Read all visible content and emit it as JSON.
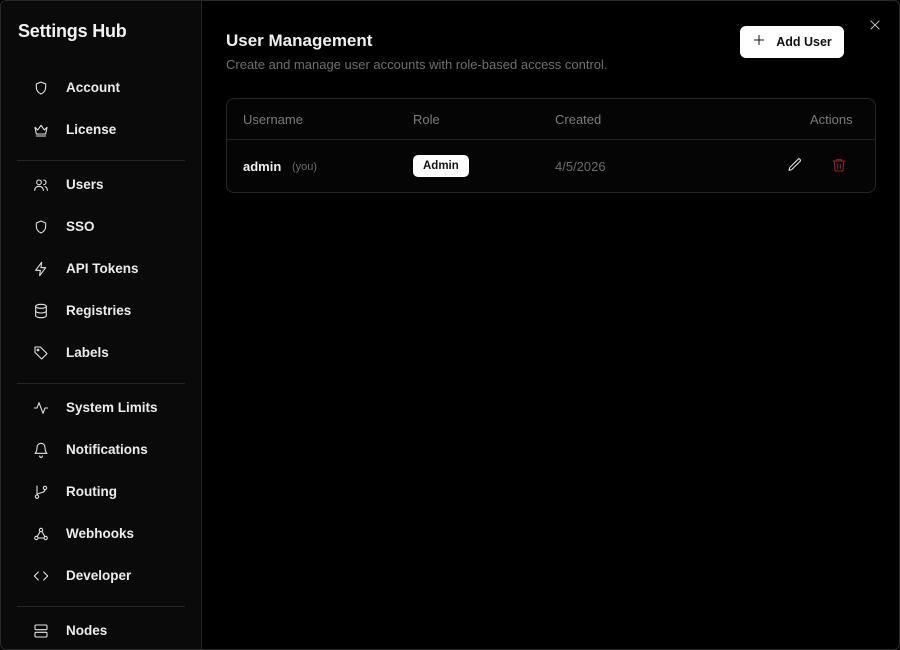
{
  "sidebar": {
    "title": "Settings Hub",
    "groups": [
      [
        {
          "label": "Account",
          "icon": "shield-icon"
        },
        {
          "label": "License",
          "icon": "crown-icon"
        }
      ],
      [
        {
          "label": "Users",
          "icon": "users-icon"
        },
        {
          "label": "SSO",
          "icon": "shield-icon"
        },
        {
          "label": "API Tokens",
          "icon": "lightning-icon"
        },
        {
          "label": "Registries",
          "icon": "database-icon"
        },
        {
          "label": "Labels",
          "icon": "tag-icon"
        }
      ],
      [
        {
          "label": "System Limits",
          "icon": "activity-icon"
        },
        {
          "label": "Notifications",
          "icon": "bell-icon"
        },
        {
          "label": "Routing",
          "icon": "git-branch-icon"
        },
        {
          "label": "Webhooks",
          "icon": "webhook-icon"
        },
        {
          "label": "Developer",
          "icon": "code-icon"
        }
      ],
      [
        {
          "label": "Nodes",
          "icon": "server-icon"
        }
      ]
    ]
  },
  "main": {
    "title": "User Management",
    "subtitle": "Create and manage user accounts with role-based access control.",
    "add_button": "Add User",
    "table": {
      "headers": {
        "username": "Username",
        "role": "Role",
        "created": "Created",
        "actions": "Actions"
      },
      "rows": [
        {
          "username": "admin",
          "you_tag": "(you)",
          "role": "Admin",
          "created": "4/5/2026"
        }
      ]
    }
  },
  "colors": {
    "background": "#000000",
    "sidebar_bg": "#0a0a0a",
    "accent_button": "#ffffff",
    "delete_icon": "#8b2525",
    "muted_text": "#6f6f6f"
  }
}
